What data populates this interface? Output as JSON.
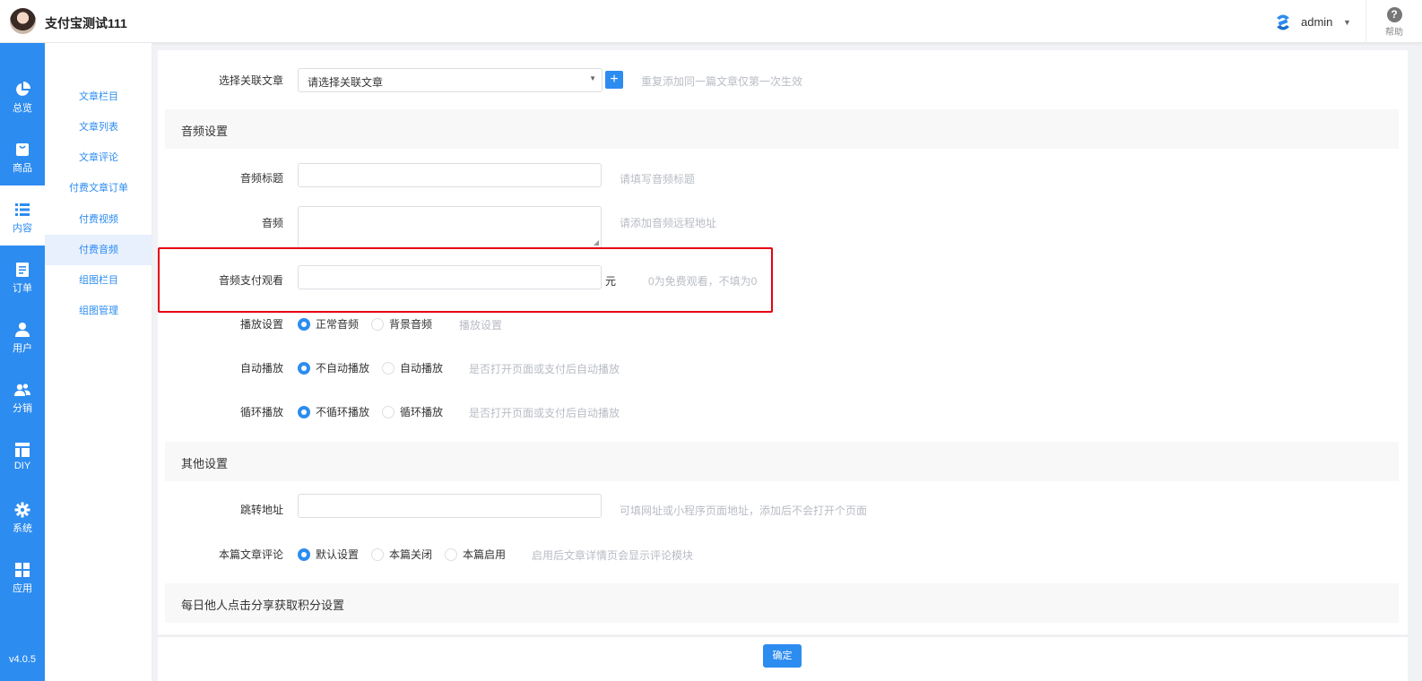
{
  "header": {
    "store_name": "支付宝测试111",
    "user_name": "admin",
    "help_label": "帮助"
  },
  "rail": {
    "items": [
      {
        "label": "总览",
        "icon": "pie-chart-icon"
      },
      {
        "label": "商品",
        "icon": "shopping-bag-icon"
      },
      {
        "label": "内容",
        "icon": "list-icon"
      },
      {
        "label": "订单",
        "icon": "order-document-icon"
      },
      {
        "label": "用户",
        "icon": "user-icon"
      },
      {
        "label": "分销",
        "icon": "users-group-icon"
      },
      {
        "label": "DIY",
        "icon": "layout-icon"
      },
      {
        "label": "系统",
        "icon": "gear-icon"
      },
      {
        "label": "应用",
        "icon": "apps-grid-icon"
      }
    ],
    "active_index": 2,
    "version": "v4.0.5"
  },
  "subnav": {
    "items": [
      "文章栏目",
      "文章列表",
      "文章评论",
      "付费文章订单",
      "付费视频",
      "付费音频",
      "组图栏目",
      "组图管理"
    ],
    "active_index": 5
  },
  "form": {
    "related_article": {
      "label": "选择关联文章",
      "select_value": "请选择关联文章",
      "hint": "重复添加同一篇文章仅第一次生效"
    },
    "audio_section": {
      "title": "音频设置",
      "audio_title_label": "音频标题",
      "audio_title_hint": "请填写音频标题",
      "audio_label": "音频",
      "audio_hint": "请添加音频远程地址",
      "pay_label": "音频支付观看",
      "pay_unit": "元",
      "pay_hint": "0为免费观看，不填为0",
      "play_setting_label": "播放设置",
      "play_setting_options": [
        "正常音频",
        "背景音频"
      ],
      "play_setting_hint": "播放设置",
      "autoplay_label": "自动播放",
      "autoplay_options": [
        "不自动播放",
        "自动播放"
      ],
      "autoplay_hint": "是否打开页面或支付后自动播放",
      "loop_label": "循环播放",
      "loop_options": [
        "不循环播放",
        "循环播放"
      ],
      "loop_hint": "是否打开页面或支付后自动播放"
    },
    "other_section": {
      "title": "其他设置",
      "jump_label": "跳转地址",
      "jump_hint": "可填网址或小程序页面地址，添加后不会打开个页面",
      "comment_label": "本篇文章评论",
      "comment_options": [
        "默认设置",
        "本篇关闭",
        "本篇启用"
      ],
      "comment_hint": "启用后文章详情页会显示评论模块"
    },
    "share_section": {
      "title": "每日他人点击分享获取积分设置"
    },
    "confirm_label": "确定"
  },
  "colors": {
    "primary": "#2d8cf0",
    "highlight_border": "#e60012"
  }
}
